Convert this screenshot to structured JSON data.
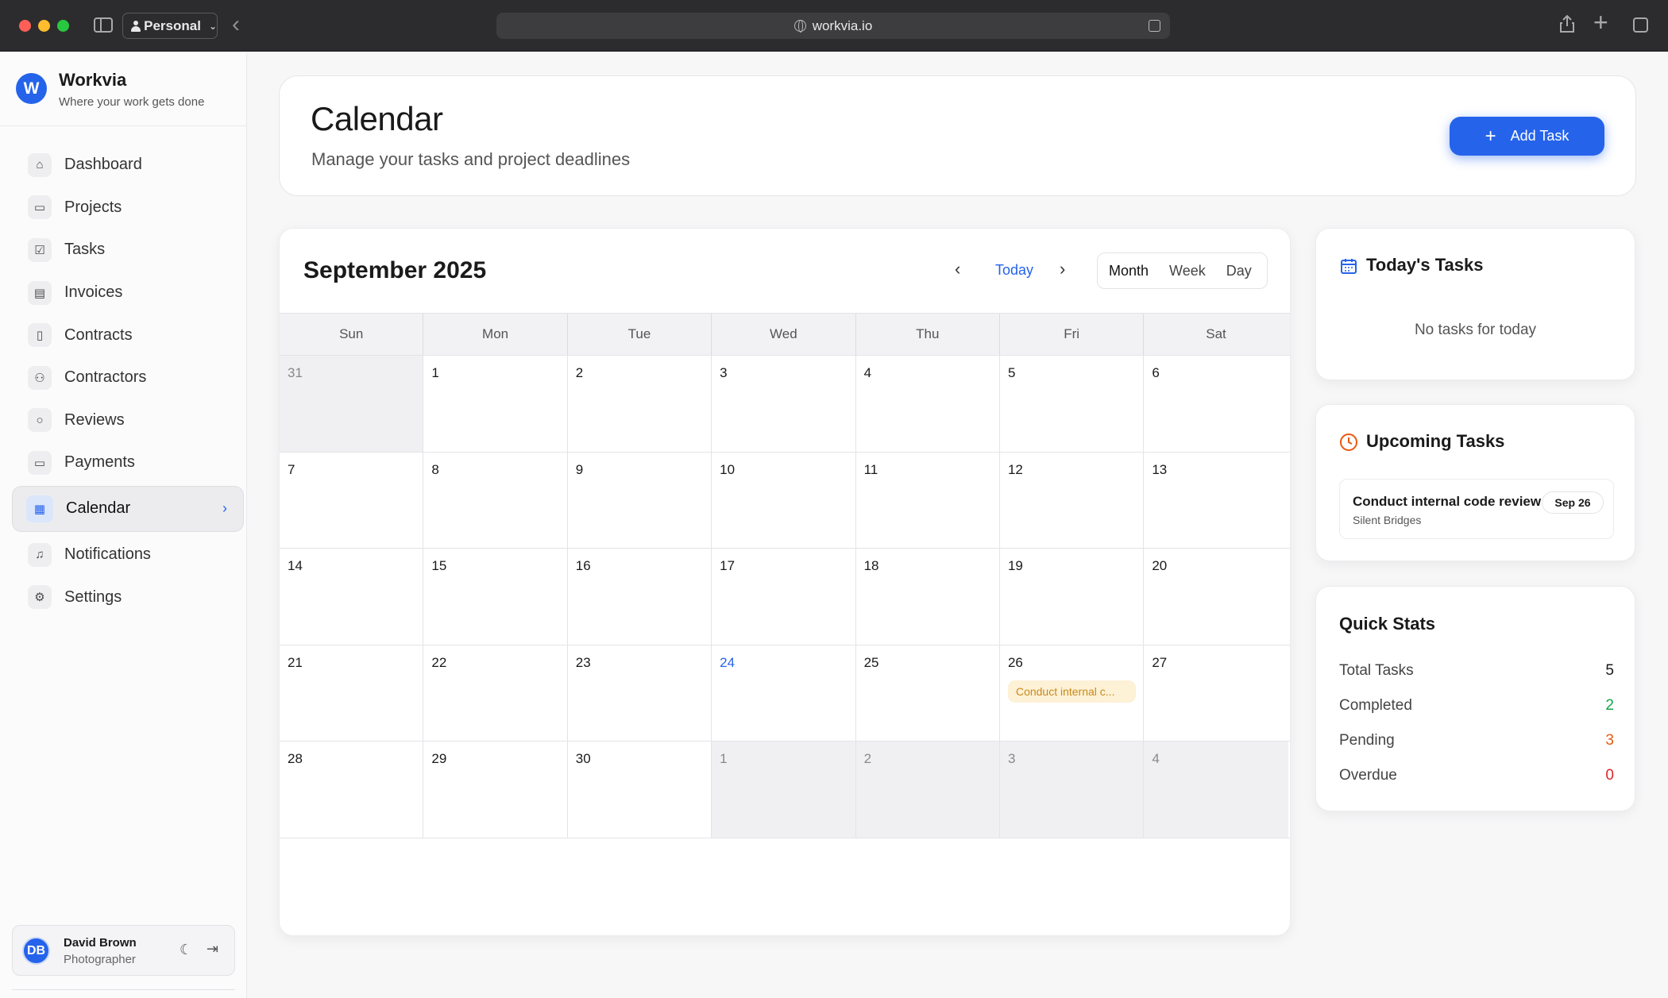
{
  "browser": {
    "profile": "Personal",
    "url": "workvia.io"
  },
  "app": {
    "name": "Workvia",
    "tagline": "Where your work gets done",
    "logo_letter": "W"
  },
  "sidebar": {
    "items": [
      {
        "label": "Dashboard",
        "icon": "home-icon"
      },
      {
        "label": "Projects",
        "icon": "folder-icon"
      },
      {
        "label": "Tasks",
        "icon": "checkbox-icon"
      },
      {
        "label": "Invoices",
        "icon": "document-icon"
      },
      {
        "label": "Contracts",
        "icon": "contract-icon"
      },
      {
        "label": "Contractors",
        "icon": "users-icon"
      },
      {
        "label": "Reviews",
        "icon": "chat-icon"
      },
      {
        "label": "Payments",
        "icon": "credit-card-icon"
      },
      {
        "label": "Calendar",
        "icon": "calendar-icon",
        "active": true
      },
      {
        "label": "Notifications",
        "icon": "bell-icon"
      },
      {
        "label": "Settings",
        "icon": "gear-icon"
      }
    ]
  },
  "user": {
    "initials": "DB",
    "name": "David Brown",
    "role": "Photographer"
  },
  "header": {
    "title": "Calendar",
    "subtitle": "Manage your tasks and project deadlines",
    "add_task_label": "Add Task"
  },
  "calendar": {
    "month_label": "September 2025",
    "today_label": "Today",
    "views": [
      "Month",
      "Week",
      "Day"
    ],
    "active_view": "Month",
    "weekdays": [
      "Sun",
      "Mon",
      "Tue",
      "Wed",
      "Thu",
      "Fri",
      "Sat"
    ],
    "weeks": [
      [
        {
          "d": "31",
          "other": true
        },
        {
          "d": "1"
        },
        {
          "d": "2"
        },
        {
          "d": "3"
        },
        {
          "d": "4"
        },
        {
          "d": "5"
        },
        {
          "d": "6"
        }
      ],
      [
        {
          "d": "7"
        },
        {
          "d": "8"
        },
        {
          "d": "9"
        },
        {
          "d": "10"
        },
        {
          "d": "11"
        },
        {
          "d": "12"
        },
        {
          "d": "13"
        }
      ],
      [
        {
          "d": "14"
        },
        {
          "d": "15"
        },
        {
          "d": "16"
        },
        {
          "d": "17"
        },
        {
          "d": "18"
        },
        {
          "d": "19"
        },
        {
          "d": "20"
        }
      ],
      [
        {
          "d": "21"
        },
        {
          "d": "22"
        },
        {
          "d": "23"
        },
        {
          "d": "24",
          "today": true
        },
        {
          "d": "25"
        },
        {
          "d": "26",
          "event": "Conduct internal c..."
        },
        {
          "d": "27"
        }
      ],
      [
        {
          "d": "28"
        },
        {
          "d": "29"
        },
        {
          "d": "30"
        },
        {
          "d": "1",
          "other": true
        },
        {
          "d": "2",
          "other": true
        },
        {
          "d": "3",
          "other": true
        },
        {
          "d": "4",
          "other": true
        }
      ]
    ]
  },
  "today_tasks": {
    "title": "Today's Tasks",
    "empty": "No tasks for today"
  },
  "upcoming": {
    "title": "Upcoming Tasks",
    "items": [
      {
        "title": "Conduct internal code review",
        "subtitle": "Silent Bridges",
        "date": "Sep 26"
      }
    ]
  },
  "stats": {
    "title": "Quick Stats",
    "rows": [
      {
        "label": "Total Tasks",
        "value": "5",
        "color": "#1a1a1a"
      },
      {
        "label": "Completed",
        "value": "2",
        "color": "#16a34a"
      },
      {
        "label": "Pending",
        "value": "3",
        "color": "#ea580c"
      },
      {
        "label": "Overdue",
        "value": "0",
        "color": "#dc2626"
      }
    ]
  },
  "colors": {
    "accent": "#2563eb",
    "event_bg": "#fdf1d6",
    "event_text": "#c98a1a"
  }
}
